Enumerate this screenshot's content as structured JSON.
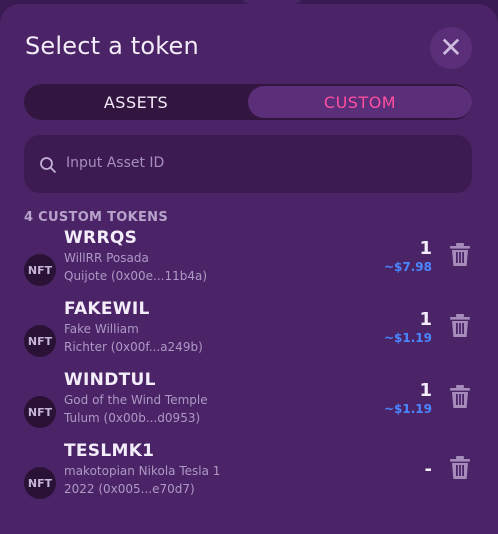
{
  "header": {
    "title": "Select a token",
    "close_label": "✕"
  },
  "tabs": [
    {
      "label": "ASSETS"
    },
    {
      "label": "CUSTOM"
    }
  ],
  "search": {
    "placeholder": "Input Asset ID"
  },
  "list": {
    "title": "4 CUSTOM TOKENS",
    "items": [
      {
        "badge": "NFT",
        "symbol": "WRRQS",
        "name_line1": "WillRR Posada",
        "name_line2": "Quijote (0x00e...11b4a)",
        "amount": "1",
        "usd": "~$7.98"
      },
      {
        "badge": "NFT",
        "symbol": "FAKEWIL",
        "name_line1": "Fake William",
        "name_line2": "Richter (0x00f...a249b)",
        "amount": "1",
        "usd": "~$1.19"
      },
      {
        "badge": "NFT",
        "symbol": "WINDTUL",
        "name_line1": "God of the Wind Temple",
        "name_line2": "Tulum (0x00b...d0953)",
        "amount": "1",
        "usd": "~$1.19"
      },
      {
        "badge": "NFT",
        "symbol": "TESLMK1",
        "name_line1": "makotopian Nikola Tesla 1",
        "name_line2": "2022 (0x005...e70d7)",
        "amount": "-",
        "usd": ""
      }
    ]
  },
  "colors": {
    "background": "#4b2467",
    "accent_pink": "#ff4fa0",
    "usd_blue": "#4a86ff"
  },
  "icons": {
    "close": "close-icon",
    "search": "search-icon",
    "delete": "trash-icon"
  }
}
